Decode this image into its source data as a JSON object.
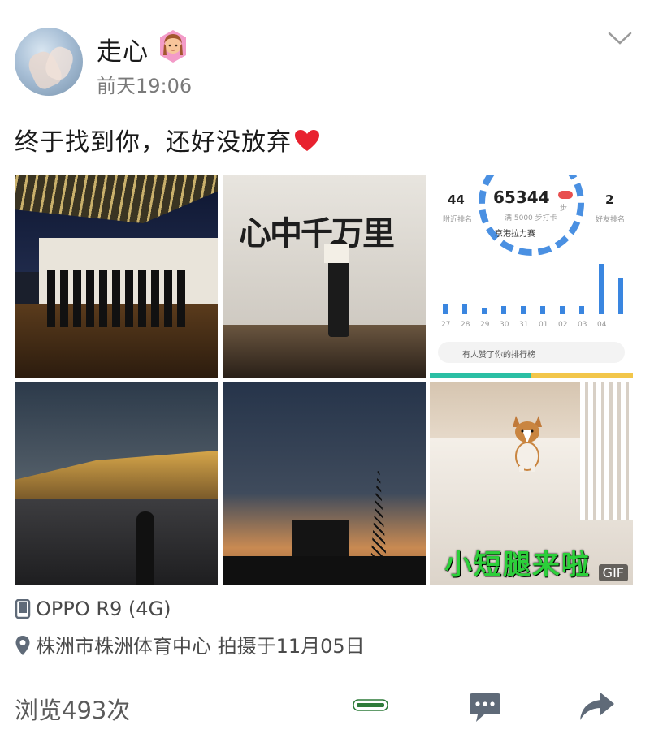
{
  "post": {
    "username": "走心",
    "timestamp": "前天19:06",
    "text": "终于找到你，还好没放弃",
    "device": "OPPO R9 (4G)",
    "location": "株洲市株洲体育中心  拍摄于11月05日",
    "views": "浏览493次"
  },
  "images": {
    "t1_text": "心中千万里",
    "t3": {
      "left_num": "44",
      "left_label": "附近排名",
      "steps": "65344",
      "steps_unit": "步",
      "steps_sub": "满 5000 步打卡",
      "right_num": "2",
      "right_label": "好友排名",
      "race": "京港拉力赛",
      "x_labels": [
        "27",
        "28",
        "29",
        "30",
        "31",
        "01",
        "02",
        "03",
        "04"
      ],
      "bar_values": [
        0.12,
        0.12,
        0.08,
        0.1,
        0.1,
        0.1,
        0.1,
        0.1,
        0.62,
        0.45
      ],
      "pill_text": "有人赞了你的排行榜",
      "badge_count": "1"
    },
    "t6_caption": "小短腿来啦",
    "gif_label": "GIF"
  },
  "icons": {
    "more": "chevron-down-icon",
    "device": "phone-icon",
    "location": "location-pin-icon",
    "comment": "comment-icon",
    "share": "share-icon"
  },
  "colors": {
    "heart": "#e8222f",
    "accent_blue": "#3a86e0",
    "gif_caption": "#2ccf3a",
    "icon_gray": "#5f6a78"
  }
}
